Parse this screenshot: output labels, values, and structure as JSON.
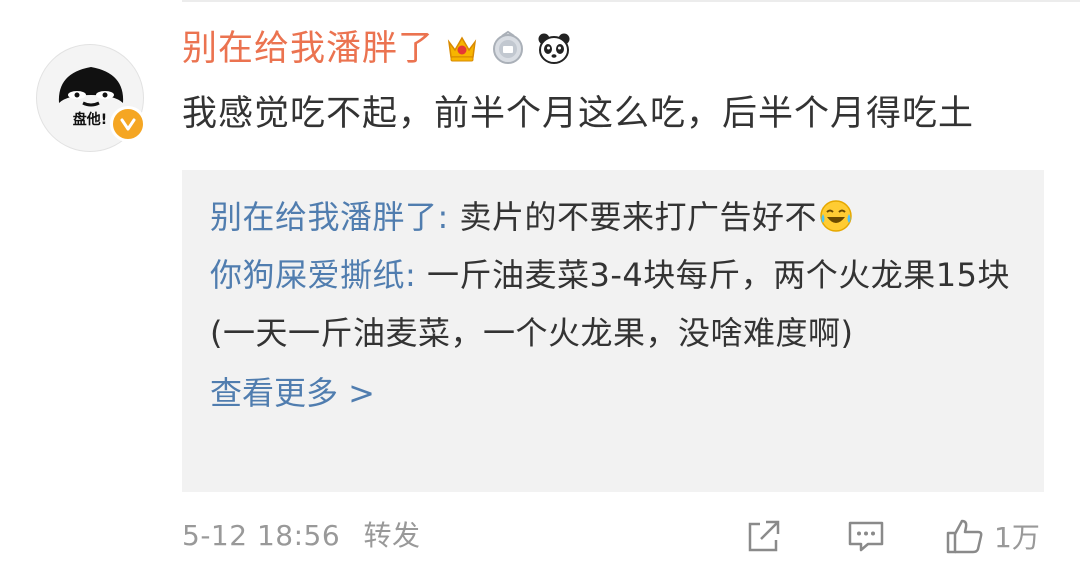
{
  "comment": {
    "avatar_caption": "盘他!",
    "username": "别在给我潘胖了",
    "badges": [
      "crown-badge",
      "silver-medal-badge",
      "panda-badge"
    ],
    "text": "我感觉吃不起，前半个月这么吃，后半个月得吃土"
  },
  "replies": [
    {
      "user": "别在给我潘胖了",
      "sep": ":",
      "text": " 卖片的不要来打广告好不",
      "emoji": "laugh-cry-emoji"
    },
    {
      "user": "你狗屎爱撕纸",
      "sep": ":",
      "text": " 一斤油麦菜3-4块每斤，两个火龙果15块(一天一斤油麦菜，一个火龙果，没啥难度啊)"
    }
  ],
  "more_link": "查看更多 >",
  "footer": {
    "date": "5-12 18:56",
    "repost_label": "转发",
    "like_count": "1万"
  },
  "colors": {
    "username": "#eb7350",
    "link": "#507daf",
    "text": "#333333",
    "muted": "#999999",
    "reply_bg": "#f2f2f2"
  }
}
